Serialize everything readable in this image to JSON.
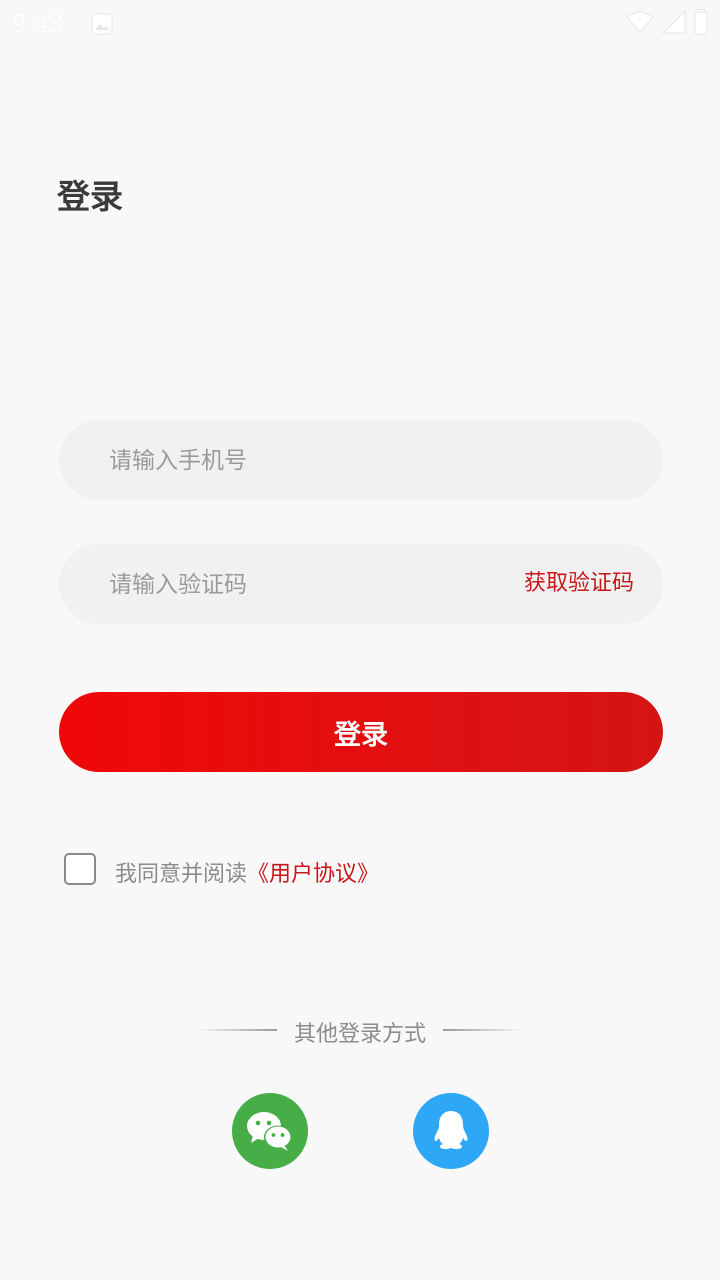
{
  "status_bar": {
    "time": "9:43",
    "icons": [
      "image-icon",
      "wifi-icon",
      "signal-icon",
      "battery-icon"
    ]
  },
  "page": {
    "title": "登录"
  },
  "form": {
    "phone_placeholder": "请输入手机号",
    "phone_value": "",
    "code_placeholder": "请输入验证码",
    "code_value": "",
    "get_code_label": "获取验证码",
    "login_label": "登录"
  },
  "agreement": {
    "checked": false,
    "prefix": "我同意并阅读",
    "link_label": "《用户协议》"
  },
  "other_login": {
    "title": "其他登录方式",
    "providers": [
      {
        "icon": "wechat-icon",
        "color": "#46ad47"
      },
      {
        "icon": "qq-icon",
        "color": "#2ea7f6"
      }
    ]
  },
  "colors": {
    "accent": "#e10f10",
    "link": "#c8171a",
    "background": "#f8f8f8",
    "input_bg": "#f1f1f1"
  }
}
